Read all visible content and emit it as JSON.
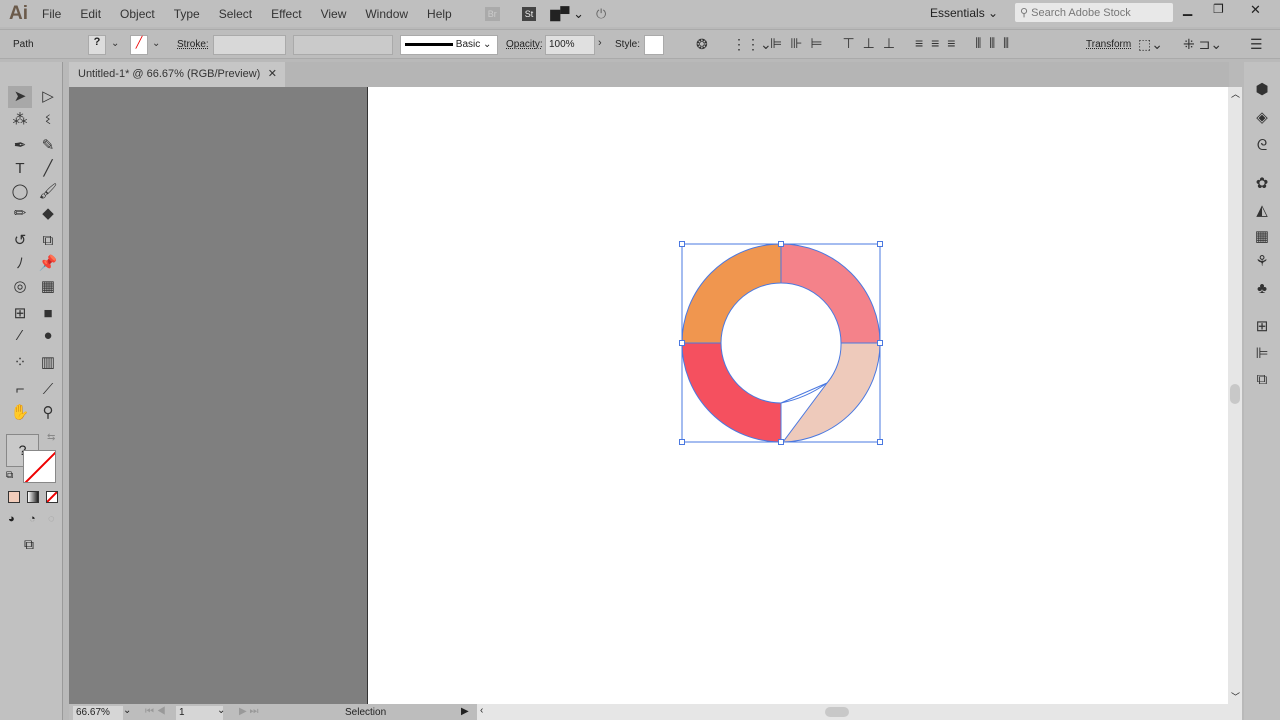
{
  "app": {
    "logo": "Ai",
    "menus": [
      "File",
      "Edit",
      "Object",
      "Type",
      "Select",
      "Effect",
      "View",
      "Window",
      "Help"
    ],
    "bridge": "Br",
    "stock": "St",
    "workspace": "Essentials",
    "search_placeholder": "Search Adobe Stock"
  },
  "control": {
    "selection_type": "Path",
    "fill_value": "?",
    "stroke_label": "Stroke:",
    "brush_label": "Basic",
    "opacity_label": "Opacity:",
    "opacity_value": "100%",
    "style_label": "Style:",
    "transform_label": "Transform"
  },
  "document": {
    "tab_title": "Untitled-1* @ 66.67% (RGB/Preview)"
  },
  "status": {
    "zoom": "66.67%",
    "artboard": "1",
    "tool": "Selection"
  },
  "artwork": {
    "colors": {
      "top_left": "#f0964f",
      "top_right": "#f4828a",
      "bottom_left": "#f5505f",
      "bottom_right": "#eecabb",
      "selection": "#4a78e0"
    }
  },
  "tools": [
    [
      "selection-tool",
      "➤"
    ],
    [
      "direct-selection-tool",
      "▷"
    ],
    [
      "magic-wand-tool",
      "⁂"
    ],
    [
      "lasso-tool",
      "ଽ"
    ],
    [
      "pen-tool",
      "✒"
    ],
    [
      "curvature-tool",
      "✎"
    ],
    [
      "type-tool",
      "T"
    ],
    [
      "line-tool",
      "╱"
    ],
    [
      "ellipse-tool",
      "◯"
    ],
    [
      "paintbrush-tool",
      "🖌"
    ],
    [
      "pencil-tool",
      "✏"
    ],
    [
      "eraser-tool",
      "◆"
    ],
    [
      "rotate-tool",
      "↺"
    ],
    [
      "scale-tool",
      "⧉"
    ],
    [
      "warp-tool",
      "ﾉ"
    ],
    [
      "puppet-warp-tool",
      "📌"
    ],
    [
      "shape-builder-tool",
      "◎"
    ],
    [
      "perspective-grid-tool",
      "▦"
    ],
    [
      "mesh-tool",
      "⊞"
    ],
    [
      "gradient-tool",
      "■"
    ],
    [
      "eyedropper-tool",
      "⁄"
    ],
    [
      "blend-tool",
      "●"
    ],
    [
      "symbol-sprayer-tool",
      "⁘"
    ],
    [
      "column-graph-tool",
      "▥"
    ],
    [
      "artboard-tool",
      "⌐"
    ],
    [
      "slice-tool",
      "⟋"
    ],
    [
      "hand-tool",
      "✋"
    ],
    [
      "zoom-tool",
      "⚲"
    ]
  ],
  "dock": [
    "cc-libraries",
    "layers",
    "creative-cloud",
    "color-palette",
    "color-guide",
    "swatches",
    "brushes",
    "symbols",
    "transform",
    "align",
    "pathfinder"
  ]
}
